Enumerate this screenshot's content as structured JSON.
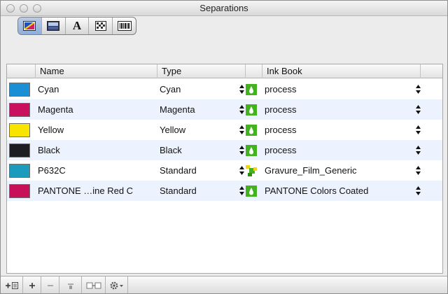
{
  "window": {
    "title": "Separations"
  },
  "toolbar": {
    "segments": [
      {
        "icon": "color-swatch-icon",
        "selected": true
      },
      {
        "icon": "image-frame-icon",
        "selected": false
      },
      {
        "icon": "text-icon",
        "label": "A",
        "selected": false
      },
      {
        "icon": "pattern-icon",
        "selected": false
      },
      {
        "icon": "barcode-icon",
        "selected": false
      }
    ]
  },
  "table": {
    "columns": {
      "name": "Name",
      "type": "Type",
      "ink_book": "Ink Book"
    },
    "rows": [
      {
        "name": "Cyan",
        "type": "Cyan",
        "ink_book": "process",
        "color": "#1a8fd6",
        "ink_icon": "process-ink-icon"
      },
      {
        "name": "Magenta",
        "type": "Magenta",
        "ink_book": "process",
        "color": "#c90f5e",
        "ink_icon": "process-ink-icon"
      },
      {
        "name": "Yellow",
        "type": "Yellow",
        "ink_book": "process",
        "color": "#f7e500",
        "ink_icon": "process-ink-icon"
      },
      {
        "name": "Black",
        "type": "Black",
        "ink_book": "process",
        "color": "#1d1d22",
        "ink_icon": "process-ink-icon"
      },
      {
        "name": "P632C",
        "type": "Standard",
        "ink_book": "Gravure_Film_Generic",
        "color": "#1c9bbd",
        "ink_icon": "spot-ink-icon"
      },
      {
        "name": "PANTONE …ine Red C",
        "type": "Standard",
        "ink_book": "PANTONE Colors Coated",
        "color": "#c8105a",
        "ink_icon": "process-ink-icon"
      }
    ]
  },
  "bottombar": {
    "buttons": [
      {
        "icon": "add-list-icon"
      },
      {
        "icon": "add-icon"
      },
      {
        "icon": "remove-icon"
      },
      {
        "icon": "merge-icon"
      },
      {
        "icon": "link-icon"
      },
      {
        "icon": "gear-menu-icon"
      }
    ]
  }
}
